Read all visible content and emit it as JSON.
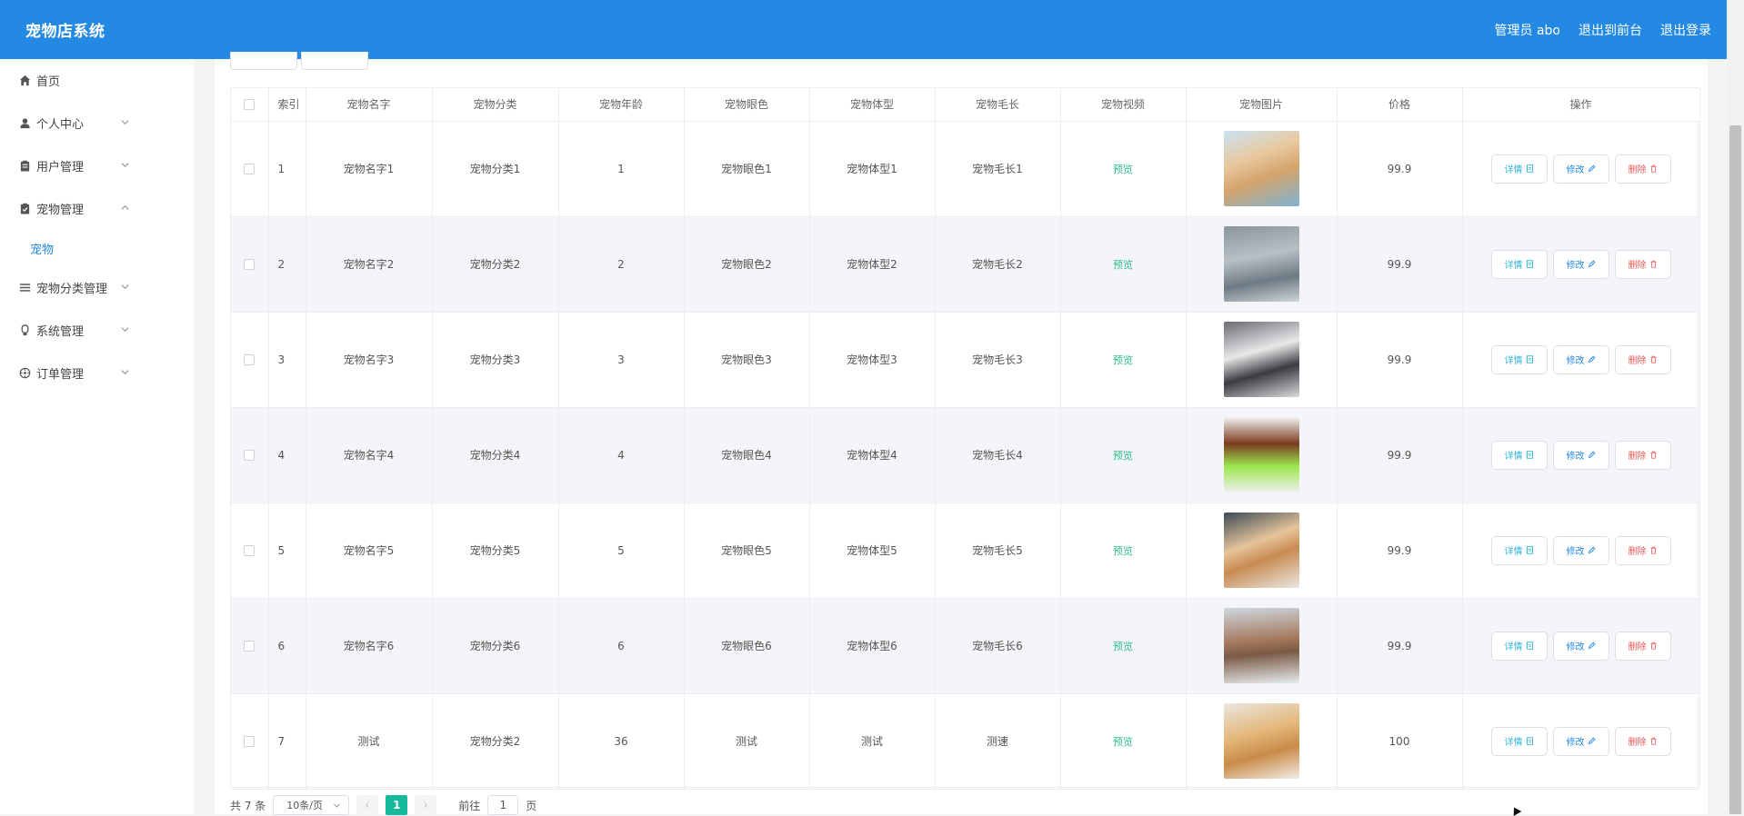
{
  "header": {
    "brand": "宠物店系统",
    "user_label": "管理员 abo",
    "to_front": "退出到前台",
    "logout": "退出登录",
    "bg_color": "#2389e2"
  },
  "sidebar": {
    "items": [
      {
        "label": "首页",
        "icon": "home-icon"
      },
      {
        "label": "个人中心",
        "icon": "user-icon"
      },
      {
        "label": "用户管理",
        "icon": "clipboard-icon"
      },
      {
        "label": "宠物管理",
        "icon": "clipboard-icon",
        "expanded": true
      },
      {
        "label": "宠物分类管理",
        "icon": "list-icon"
      },
      {
        "label": "系统管理",
        "icon": "tag-icon"
      },
      {
        "label": "订单管理",
        "icon": "compass-icon"
      }
    ],
    "sub_items": [
      {
        "label": "宠物"
      }
    ]
  },
  "table": {
    "columns": [
      "索引",
      "宠物名字",
      "宠物分类",
      "宠物年龄",
      "宠物眼色",
      "宠物体型",
      "宠物毛长",
      "宠物视频",
      "宠物图片",
      "价格",
      "操作"
    ],
    "rows": [
      {
        "index": "1",
        "name": "宠物名字1",
        "category": "宠物分类1",
        "age": "1",
        "eye": "宠物眼色1",
        "body": "宠物体型1",
        "fur": "宠物毛长1",
        "video": "预览",
        "price": "99.9",
        "image": "cat-figurine-image"
      },
      {
        "index": "2",
        "name": "宠物名字2",
        "category": "宠物分类2",
        "age": "2",
        "eye": "宠物眼色2",
        "body": "宠物体型2",
        "fur": "宠物毛长2",
        "video": "预览",
        "price": "99.9",
        "image": "gray-cat-image"
      },
      {
        "index": "3",
        "name": "宠物名字3",
        "category": "宠物分类3",
        "age": "3",
        "eye": "宠物眼色3",
        "body": "宠物体型3",
        "fur": "宠物毛长3",
        "video": "预览",
        "price": "99.9",
        "image": "husky-image"
      },
      {
        "index": "4",
        "name": "宠物名字4",
        "category": "宠物分类4",
        "age": "4",
        "eye": "宠物眼色4",
        "body": "宠物体型4",
        "fur": "宠物毛长4",
        "video": "预览",
        "price": "99.9",
        "image": "poodle-image"
      },
      {
        "index": "5",
        "name": "宠物名字5",
        "category": "宠物分类5",
        "age": "5",
        "eye": "宠物眼色5",
        "body": "宠物体型5",
        "fur": "宠物毛长5",
        "video": "预览",
        "price": "99.9",
        "image": "two-cats-image"
      },
      {
        "index": "6",
        "name": "宠物名字6",
        "category": "宠物分类6",
        "age": "6",
        "eye": "宠物眼色6",
        "body": "宠物体型6",
        "fur": "宠物毛长6",
        "video": "预览",
        "price": "99.9",
        "image": "shiba-image"
      },
      {
        "index": "7",
        "name": "测试",
        "category": "宠物分类2",
        "age": "36",
        "eye": "测试",
        "body": "测试",
        "fur": "测速",
        "video": "预览",
        "price": "100",
        "image": "golden-retriever-image"
      }
    ],
    "actions": {
      "detail": "详情",
      "edit": "修改",
      "delete": "删除"
    }
  },
  "pagination": {
    "total": "共 7 条",
    "page_size": "10条/页",
    "current_page": "1",
    "goto_prefix": "前往",
    "goto_value": "1",
    "goto_suffix": "页"
  },
  "colors": {
    "accent": "#2389e2",
    "preview": "#2dbd8c",
    "delete": "#f05656",
    "detail": "#2db3d6",
    "page_active": "#16b99b"
  }
}
